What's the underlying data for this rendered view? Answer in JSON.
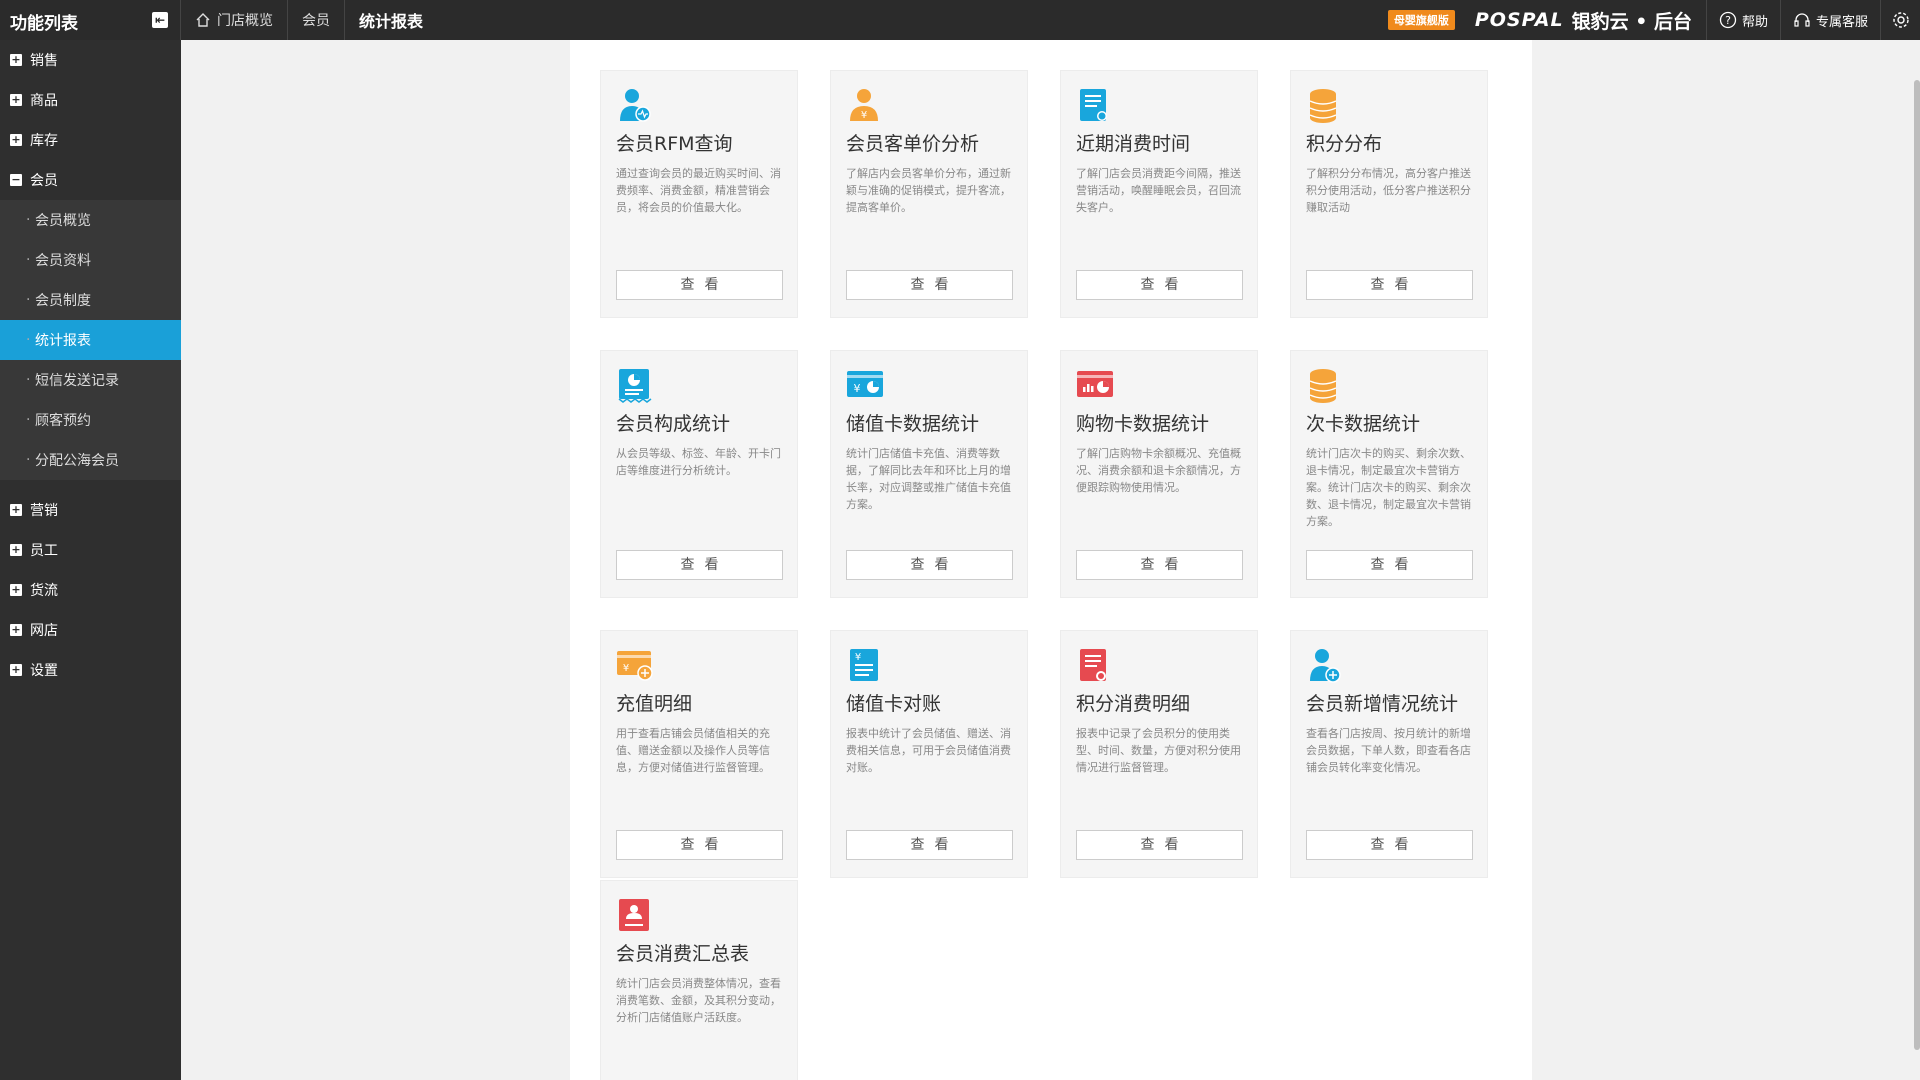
{
  "sidebar": {
    "title": "功能列表",
    "collapse_icon": "arrow-left-icon",
    "groups_top": [
      {
        "label": "销售"
      },
      {
        "label": "商品"
      },
      {
        "label": "库存"
      }
    ],
    "open_group": {
      "label": "会员"
    },
    "sub_items": [
      {
        "label": "会员概览"
      },
      {
        "label": "会员资料"
      },
      {
        "label": "会员制度"
      },
      {
        "label": "统计报表"
      },
      {
        "label": "短信发送记录"
      },
      {
        "label": "顾客预约"
      },
      {
        "label": "分配公海会员"
      }
    ],
    "active_sub": "统计报表",
    "groups_bottom": [
      {
        "label": "营销"
      },
      {
        "label": "员工"
      },
      {
        "label": "货流"
      },
      {
        "label": "网店"
      },
      {
        "label": "设置"
      }
    ]
  },
  "breadcrumb": {
    "home": "门店概览",
    "parent": "会员",
    "current": "统计报表"
  },
  "topbar": {
    "trial_badge": "母婴旗舰版",
    "brand_latin": "POSPAL",
    "brand_cn": "银豹云 • 后台",
    "help": "帮助",
    "service": "专属客服"
  },
  "colors": {
    "active": "#1aa0d8",
    "blue": "#19a6dc",
    "orange": "#f5a43a",
    "red": "#e64a50"
  },
  "view_label": "查看",
  "cards": [
    {
      "title": "会员RFM查询",
      "desc": "通过查询会员的最近购买时间、消费频率、消费金额，精准营销会员，将会员的价值最大化。",
      "icon": "member-rfm-icon",
      "color": "#19a6dc"
    },
    {
      "title": "会员客单价分析",
      "desc": "了解店内会员客单价分布，通过新颖与准确的促销模式，提升客流，提高客单价。",
      "icon": "member-price-icon",
      "color": "#f5a43a"
    },
    {
      "title": "近期消费时间",
      "desc": "了解门店会员消费距今间隔，推送营销活动，唤醒睡眠会员，召回流失客户。",
      "icon": "recent-consume-icon",
      "color": "#19a6dc"
    },
    {
      "title": "积分分布",
      "desc": "了解积分分布情况，高分客户推送积分使用活动，低分客户推送积分赚取活动",
      "icon": "coins-stack-icon",
      "color": "#f5a43a"
    },
    {
      "title": "会员构成统计",
      "desc": "从会员等级、标签、年龄、开卡门店等维度进行分析统计。",
      "icon": "pie-report-icon",
      "color": "#19a6dc"
    },
    {
      "title": "储值卡数据统计",
      "desc": "统计门店储值卡充值、消费等数据，了解同比去年和环比上月的增长率，对应调整或推广储值卡充值方案。",
      "icon": "stored-card-icon",
      "color": "#19a6dc"
    },
    {
      "title": "购物卡数据统计",
      "desc": "了解门店购物卡余额概况、充值概况、消费余额和退卡余额情况，方便跟踪购物使用情况。",
      "icon": "shopping-card-icon",
      "color": "#e64a50"
    },
    {
      "title": "次卡数据统计",
      "desc": "统计门店次卡的购买、剩余次数、退卡情况，制定最宜次卡营销方案。统计门店次卡的购买、剩余次数、退卡情况，制定最宜次卡营销方案。",
      "icon": "coins-stack-icon",
      "color": "#f5a43a"
    },
    {
      "title": "充值明细",
      "desc": "用于查看店铺会员储值相关的充值、赠送金额以及操作人员等信息，方便对储值进行监督管理。",
      "icon": "recharge-card-icon",
      "color": "#f5a43a"
    },
    {
      "title": "储值卡对账",
      "desc": "报表中统计了会员储值、赠送、消费相关信息，可用于会员储值消费对账。",
      "icon": "stored-reconcile-icon",
      "color": "#19a6dc"
    },
    {
      "title": "积分消费明细",
      "desc": "报表中记录了会员积分的使用类型、时间、数量，方便对积分使用情况进行监督管理。",
      "icon": "points-detail-icon",
      "color": "#e64a50"
    },
    {
      "title": "会员新增情况统计",
      "desc": "查看各门店按周、按月统计的新增会员数据，下单人数，即查看各店铺会员转化率变化情况。",
      "icon": "member-add-icon",
      "color": "#19a6dc"
    },
    {
      "title": "会员消费汇总表",
      "desc": "统计门店会员消费整体情况，查看消费笔数、金额，及其积分变动，分析门店储值账户活跃度。",
      "icon": "member-summary-icon",
      "color": "#e64a50"
    }
  ]
}
